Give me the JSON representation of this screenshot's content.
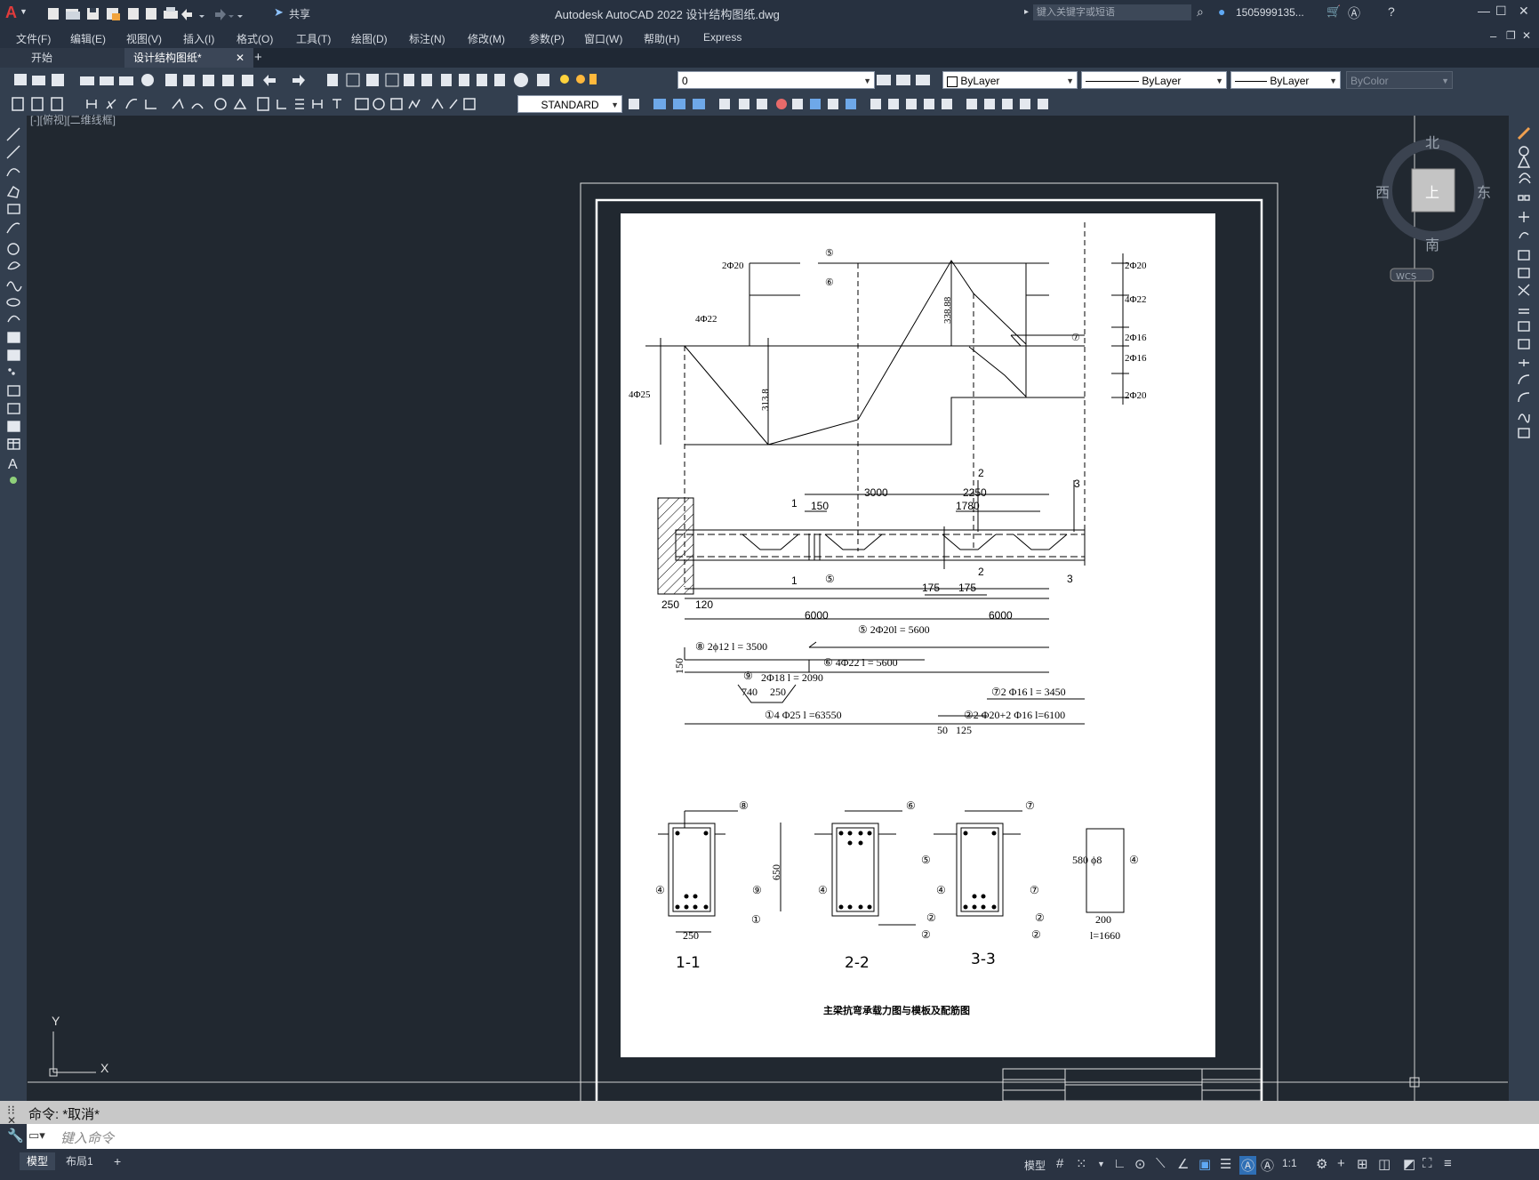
{
  "window": {
    "title": "Autodesk AutoCAD 2022    设计结构图纸.dwg",
    "share_label": "共享",
    "search_placeholder": "键入关键字或短语",
    "user": "1505999135...",
    "min": "—",
    "max": "☐",
    "close": "✕"
  },
  "menu": [
    "文件(F)",
    "编辑(E)",
    "视图(V)",
    "插入(I)",
    "格式(O)",
    "工具(T)",
    "绘图(D)",
    "标注(N)",
    "修改(M)",
    "参数(P)",
    "窗口(W)",
    "帮助(H)",
    "Express"
  ],
  "tabs": {
    "start": "开始",
    "doc": "设计结构图纸*",
    "close": "✕",
    "add": "+"
  },
  "toolbar": {
    "layer_value": "0",
    "color": "ByLayer",
    "linetype": "ByLayer",
    "lineweight": "ByLayer",
    "plotstyle": "ByColor",
    "textstyle": "STANDARD"
  },
  "viewport": {
    "label": "[-][俯视][二维线框]",
    "viewcube": {
      "north": "北",
      "south": "南",
      "east": "东",
      "west": "西",
      "top": "上",
      "wcs": "WCS"
    },
    "ucs": {
      "x": "X",
      "y": "Y"
    }
  },
  "drawing": {
    "title": "主梁抗弯承载力图与模板及配筋图",
    "moment_labels": {
      "l_2phi20": "2Φ20",
      "l_4phi22": "4Φ22",
      "l_4phi25": "4Φ25",
      "r_2phi20_top": "2Φ20",
      "r_4phi22": "4Φ22",
      "r_2phi16_a": "2Φ16",
      "r_2phi16_b": "2Φ16",
      "r_2phi20_bot": "2Φ20",
      "c5": "⑤",
      "c6": "⑥",
      "c7": "⑦",
      "dim_338": "338.88",
      "dim_313": "313.8"
    },
    "beam_labels": {
      "sec2": "2",
      "sec3": "3",
      "d2250": "2250",
      "d3000": "3000",
      "d1780": "1780",
      "d150": "150",
      "one_top": "1",
      "one_bot": "1",
      "c5b": "⑤",
      "two_bot": "2",
      "three_bot": "3",
      "d175a": "175",
      "d175b": "175",
      "d250": "250",
      "d120": "120",
      "d6000a": "6000",
      "d6000b": "6000"
    },
    "bars": {
      "b5": "⑤ 2Φ20l = 5600",
      "b8a": "⑧ 2ϕ12 l = 3500",
      "d150v": "150",
      "b6": "⑥ 4Φ22 l = 5600",
      "b9num": "⑨",
      "b9": "2Φ18 l = 2090",
      "d740": "740",
      "d250b": "250",
      "b7": "⑦2 Φ16   l = 3450",
      "b1": "①4 Φ25 l =63550",
      "b2": "②2 Φ20+2 Φ16 l=6100",
      "d50": "50",
      "d125": "125"
    },
    "sections": {
      "s1": "1-1",
      "s2": "2-2",
      "s3": "3-3",
      "d650": "650",
      "d250s": "250",
      "c8": "⑧",
      "c6s": "⑥",
      "c7s": "⑦",
      "c7b": "⑦",
      "c4a": "④",
      "c4b": "④",
      "c4c": "④",
      "c4d": "④",
      "c9": "⑨",
      "c1": "①",
      "c5s": "⑤",
      "c2a": "②",
      "c2b": "②",
      "c2c": "②",
      "c2d": "②",
      "stirrup": "580  ϕ8",
      "s200": "200",
      "sl": "l=1660"
    }
  },
  "command": {
    "history": "命令: *取消*",
    "placeholder": "键入命令"
  },
  "status": {
    "model_tab": "模型",
    "layout_tab": "布局1",
    "add": "+",
    "model_btn": "模型",
    "scale": "1:1"
  }
}
